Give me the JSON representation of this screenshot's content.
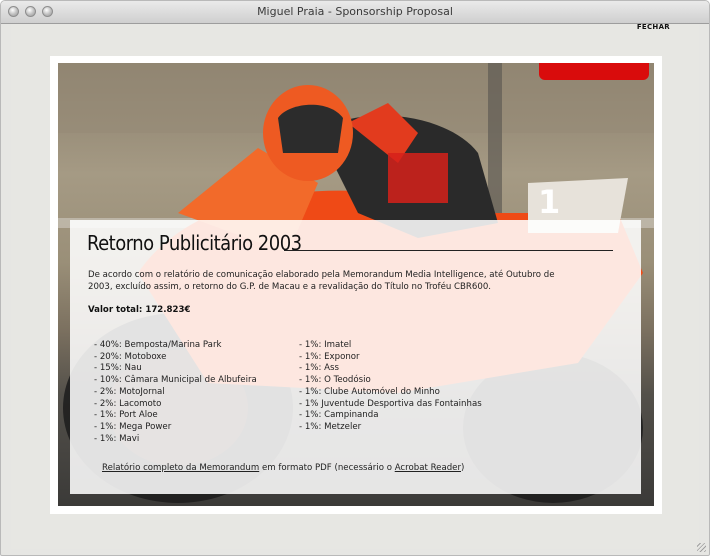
{
  "window": {
    "title": "Miguel Praia - Sponsorship Proposal"
  },
  "nav": {
    "close": "FECHAR"
  },
  "section": {
    "heading": "Retorno Publicitário 2003",
    "intro": "De acordo com o relatório de comunicação elaborado pela Memorandum Media Intelligence, até Outubro de 2003, excluído assim, o retorno do G.P. de Macau e a revalidação do Título no Troféu CBR600.",
    "total_label": "Valor total: 172.823€"
  },
  "sponsors_left": [
    "- 40%: Bemposta/Marina Park",
    "- 20%: Motoboxe",
    "- 15%: Nau",
    "- 10%: Câmara Municipal de Albufeira",
    "- 2%: MotoJornal",
    "- 2%: Lacomoto",
    "- 1%: Port Aloe",
    "- 1%: Mega Power",
    "- 1%: Mavi"
  ],
  "sponsors_right": [
    "- 1%: Imatel",
    "- 1%: Exponor",
    "- 1%: Ass",
    "- 1%: O Teodósio",
    "- 1%: Clube Automóvel do Minho",
    "- 1% Juventude Desportiva das Fontainhas",
    "- 1%: Campinanda",
    "- 1%: Metzeler"
  ],
  "footer": {
    "report_link": "Relatório completo da Memorandum",
    "middle_text": " em formato PDF (necessário o ",
    "reader_link": "Acrobat Reader",
    "end_text": ")"
  },
  "colors": {
    "accent_red": "#d90c0c",
    "titlebar": "#dcdcdc",
    "background": "#e7e7e3"
  },
  "icons": [
    "window-close-icon",
    "window-minimize-icon",
    "window-zoom-icon",
    "resize-grip-icon",
    "motorcycle-photo"
  ]
}
